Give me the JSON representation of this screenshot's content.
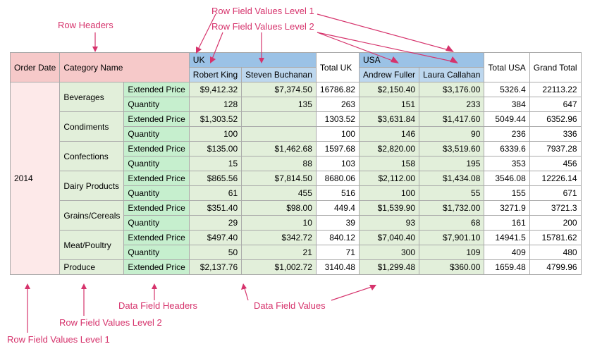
{
  "labels": {
    "row_headers": "Row Headers",
    "row_values_l1": "Row Field Values Level 1",
    "row_values_l2": "Row Field Values Level 2",
    "data_field_headers": "Data Field Headers",
    "data_field_values": "Data Field Values"
  },
  "head": {
    "order_date": "Order Date",
    "category_name": "Category Name",
    "uk": "UK",
    "usa": "USA",
    "robert": "Robert King",
    "steven": "Steven Buchanan",
    "andrew": "Andrew Fuller",
    "laura": "Laura Callahan",
    "total_uk": "Total UK",
    "total_usa": "Total USA",
    "grand_total": "Grand Total"
  },
  "year": "2014",
  "fields": {
    "ext": "Extended Price",
    "qty": "Quantity"
  },
  "cats": [
    "Beverages",
    "Condiments",
    "Confections",
    "Dairy Products",
    "Grains/Cereals",
    "Meat/Poultry",
    "Produce"
  ],
  "rows": [
    {
      "cat": 0,
      "f": "ext",
      "rk": "$9,412.32",
      "sb": "$7,374.50",
      "tuk": "16786.82",
      "af": "$2,150.40",
      "lc": "$3,176.00",
      "tus": "5326.4",
      "gt": "22113.22"
    },
    {
      "cat": 0,
      "f": "qty",
      "rk": "128",
      "sb": "135",
      "tuk": "263",
      "af": "151",
      "lc": "233",
      "tus": "384",
      "gt": "647"
    },
    {
      "cat": 1,
      "f": "ext",
      "rk": "$1,303.52",
      "sb": "",
      "tuk": "1303.52",
      "af": "$3,631.84",
      "lc": "$1,417.60",
      "tus": "5049.44",
      "gt": "6352.96"
    },
    {
      "cat": 1,
      "f": "qty",
      "rk": "100",
      "sb": "",
      "tuk": "100",
      "af": "146",
      "lc": "90",
      "tus": "236",
      "gt": "336"
    },
    {
      "cat": 2,
      "f": "ext",
      "rk": "$135.00",
      "sb": "$1,462.68",
      "tuk": "1597.68",
      "af": "$2,820.00",
      "lc": "$3,519.60",
      "tus": "6339.6",
      "gt": "7937.28"
    },
    {
      "cat": 2,
      "f": "qty",
      "rk": "15",
      "sb": "88",
      "tuk": "103",
      "af": "158",
      "lc": "195",
      "tus": "353",
      "gt": "456"
    },
    {
      "cat": 3,
      "f": "ext",
      "rk": "$865.56",
      "sb": "$7,814.50",
      "tuk": "8680.06",
      "af": "$2,112.00",
      "lc": "$1,434.08",
      "tus": "3546.08",
      "gt": "12226.14"
    },
    {
      "cat": 3,
      "f": "qty",
      "rk": "61",
      "sb": "455",
      "tuk": "516",
      "af": "100",
      "lc": "55",
      "tus": "155",
      "gt": "671"
    },
    {
      "cat": 4,
      "f": "ext",
      "rk": "$351.40",
      "sb": "$98.00",
      "tuk": "449.4",
      "af": "$1,539.90",
      "lc": "$1,732.00",
      "tus": "3271.9",
      "gt": "3721.3"
    },
    {
      "cat": 4,
      "f": "qty",
      "rk": "29",
      "sb": "10",
      "tuk": "39",
      "af": "93",
      "lc": "68",
      "tus": "161",
      "gt": "200"
    },
    {
      "cat": 5,
      "f": "ext",
      "rk": "$497.40",
      "sb": "$342.72",
      "tuk": "840.12",
      "af": "$7,040.40",
      "lc": "$7,901.10",
      "tus": "14941.5",
      "gt": "15781.62"
    },
    {
      "cat": 5,
      "f": "qty",
      "rk": "50",
      "sb": "21",
      "tuk": "71",
      "af": "300",
      "lc": "109",
      "tus": "409",
      "gt": "480"
    },
    {
      "cat": 6,
      "f": "ext",
      "rk": "$2,137.76",
      "sb": "$1,002.72",
      "tuk": "3140.48",
      "af": "$1,299.48",
      "lc": "$360.00",
      "tus": "1659.48",
      "gt": "4799.96"
    }
  ]
}
